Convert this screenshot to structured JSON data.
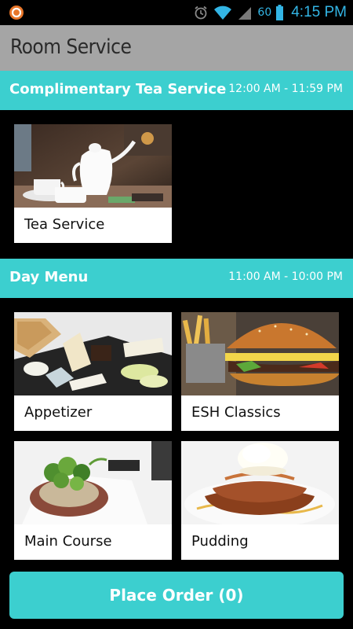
{
  "status_bar": {
    "battery_level": "60",
    "time": "4:15 PM"
  },
  "title_bar": {
    "title": "Room Service"
  },
  "sections": [
    {
      "name": "Complimentary Tea Service",
      "hours": "12:00 AM - 11:59 PM",
      "items": [
        {
          "label": "Tea Service"
        }
      ]
    },
    {
      "name": "Day Menu",
      "hours": "11:00 AM - 10:00 PM",
      "items": [
        {
          "label": "Appetizer"
        },
        {
          "label": "ESH Classics"
        },
        {
          "label": "Main Course"
        },
        {
          "label": "Pudding"
        }
      ]
    }
  ],
  "footer": {
    "place_order_label": "Place Order (0)"
  },
  "colors": {
    "accent": "#3ccfcf",
    "title_bar": "#a5a5a5",
    "status_icons": "#33b5e5"
  }
}
